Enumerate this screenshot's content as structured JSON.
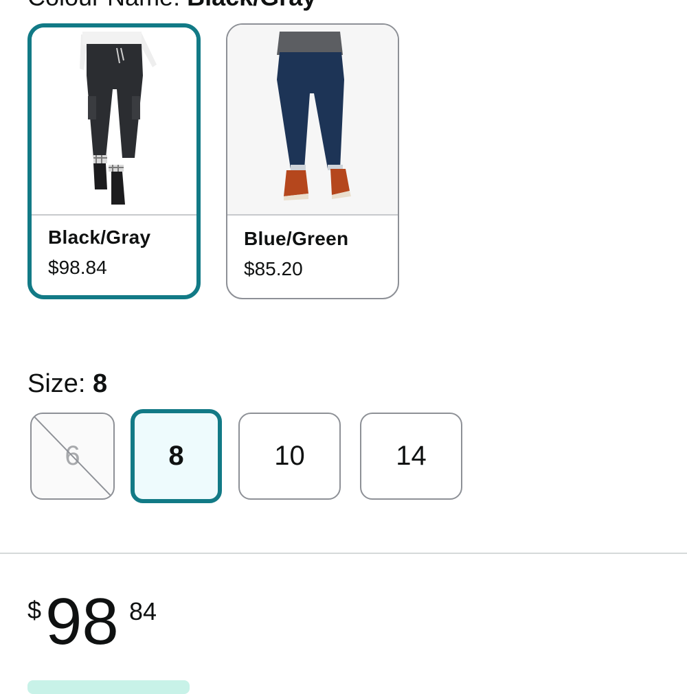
{
  "colour": {
    "label": "Colour Name:",
    "selected": "Black/Gray",
    "options": [
      {
        "name": "Black/Gray",
        "price": "$98.84",
        "selected": true
      },
      {
        "name": "Blue/Green",
        "price": "$85.20",
        "selected": false
      }
    ]
  },
  "size": {
    "label": "Size:",
    "selected": "8",
    "options": [
      {
        "label": "6",
        "available": false
      },
      {
        "label": "8",
        "selected": true
      },
      {
        "label": "10"
      },
      {
        "label": "14"
      }
    ]
  },
  "price": {
    "symbol": "$",
    "whole": "98",
    "fraction": "84"
  },
  "colors": {
    "accent": "#127a86",
    "selected_bg": "#eefbfd",
    "border": "#8d9096",
    "badge": "#c8f2e8"
  }
}
